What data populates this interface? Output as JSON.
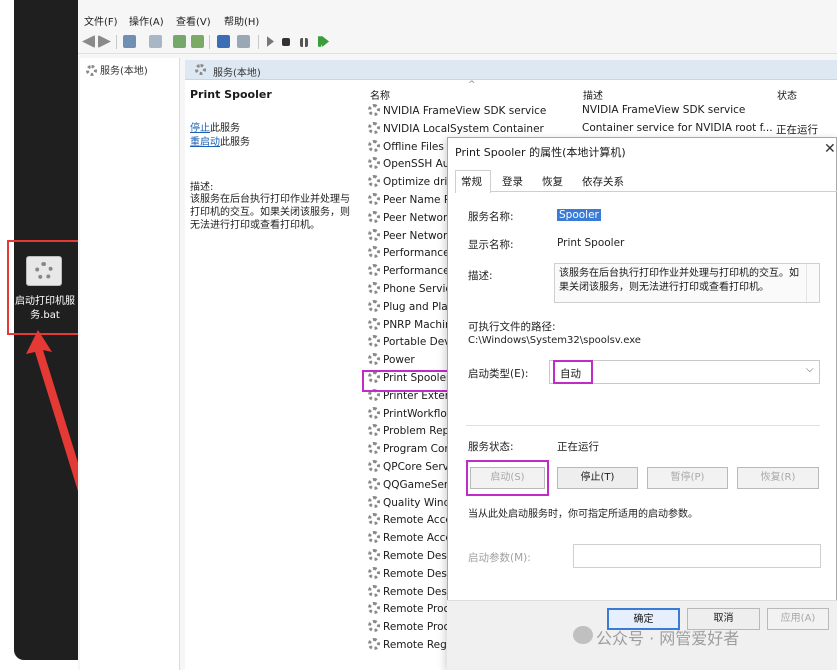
{
  "menu": [
    "文件(F)",
    "操作(A)",
    "查看(V)",
    "帮助(H)"
  ],
  "desktop_file": {
    "label": "启动打印机服务.bat"
  },
  "tree": {
    "node": "服务(本地)"
  },
  "pane": {
    "header": "服务(本地)",
    "selected_service": "Print Spooler",
    "stop_link": "停止",
    "stop_suffix": "此服务",
    "restart_link": "重启动",
    "restart_suffix": "此服务",
    "desc_label": "描述:",
    "desc_text": "该服务在后台执行打印作业并处理与打印机的交互。如果关闭该服务，则无法进行打印或查看打印机。"
  },
  "list": {
    "columns": {
      "name": "名称",
      "desc": "描述",
      "status": "状态"
    },
    "rows": [
      {
        "name": "NVIDIA FrameView SDK service",
        "desc": "NVIDIA FrameView SDK service",
        "status": ""
      },
      {
        "name": "NVIDIA LocalSystem Container",
        "desc": "Container service for NVIDIA root f...",
        "status": "正在运行"
      },
      {
        "name": "Offline Files",
        "desc": "",
        "status": ""
      },
      {
        "name": "OpenSSH Au",
        "desc": "",
        "status": ""
      },
      {
        "name": "Optimize driv",
        "desc": "",
        "status": ""
      },
      {
        "name": "Peer Name R",
        "desc": "",
        "status": ""
      },
      {
        "name": "Peer Networ",
        "desc": "",
        "status": ""
      },
      {
        "name": "Peer Networ",
        "desc": "",
        "status": ""
      },
      {
        "name": "Performance",
        "desc": "",
        "status": ""
      },
      {
        "name": "Performance",
        "desc": "",
        "status": ""
      },
      {
        "name": "Phone Servic",
        "desc": "",
        "status": ""
      },
      {
        "name": "Plug and Play",
        "desc": "",
        "status": ""
      },
      {
        "name": "PNRP Machin",
        "desc": "",
        "status": ""
      },
      {
        "name": "Portable Devi",
        "desc": "",
        "status": ""
      },
      {
        "name": "Power",
        "desc": "",
        "status": ""
      },
      {
        "name": "Print Spooler",
        "desc": "",
        "status": ""
      },
      {
        "name": "Printer Exten",
        "desc": "",
        "status": ""
      },
      {
        "name": "PrintWorkflo",
        "desc": "",
        "status": ""
      },
      {
        "name": "Problem Rep",
        "desc": "",
        "status": ""
      },
      {
        "name": "Program Con",
        "desc": "",
        "status": ""
      },
      {
        "name": "QPCore Servi",
        "desc": "",
        "status": ""
      },
      {
        "name": "QQGameServ",
        "desc": "",
        "status": ""
      },
      {
        "name": "Quality Windo",
        "desc": "",
        "status": ""
      },
      {
        "name": "Remote Acce",
        "desc": "",
        "status": ""
      },
      {
        "name": "Remote Acce",
        "desc": "",
        "status": ""
      },
      {
        "name": "Remote Desk",
        "desc": "",
        "status": ""
      },
      {
        "name": "Remote Desk",
        "desc": "",
        "status": ""
      },
      {
        "name": "Remote Desk",
        "desc": "",
        "status": ""
      },
      {
        "name": "Remote Proc",
        "desc": "",
        "status": ""
      },
      {
        "name": "Remote Proc",
        "desc": "",
        "status": ""
      },
      {
        "name": "Remote Registry",
        "desc": "",
        "status": ""
      }
    ]
  },
  "dialog": {
    "title": "Print Spooler 的属性(本地计算机)",
    "tabs": [
      "常规",
      "登录",
      "恢复",
      "依存关系"
    ],
    "service_name_label": "服务名称:",
    "service_name": "Spooler",
    "display_name_label": "显示名称:",
    "display_name": "Print Spooler",
    "desc_label": "描述:",
    "desc": "该服务在后台执行打印作业并处理与打印机的交互。如果关闭该服务，则无法进行打印或查看打印机。",
    "exe_label": "可执行文件的路径:",
    "exe_path": "C:\\Windows\\System32\\spoolsv.exe",
    "startup_label": "启动类型(E):",
    "startup_value": "自动",
    "status_label": "服务状态:",
    "status_value": "正在运行",
    "btn_start": "启动(S)",
    "btn_stop": "停止(T)",
    "btn_pause": "暂停(P)",
    "btn_resume": "恢复(R)",
    "hint": "当从此处启动服务时，你可指定所适用的启动参数。",
    "params_label": "启动参数(M):",
    "btn_ok": "确定",
    "btn_cancel": "取消",
    "btn_apply": "应用(A)"
  },
  "watermark": "公众号 · 网管爱好者",
  "colors": {
    "highlight": "#c02cc8",
    "red_annotation": "#e53935",
    "selection": "#3a7bd5"
  }
}
